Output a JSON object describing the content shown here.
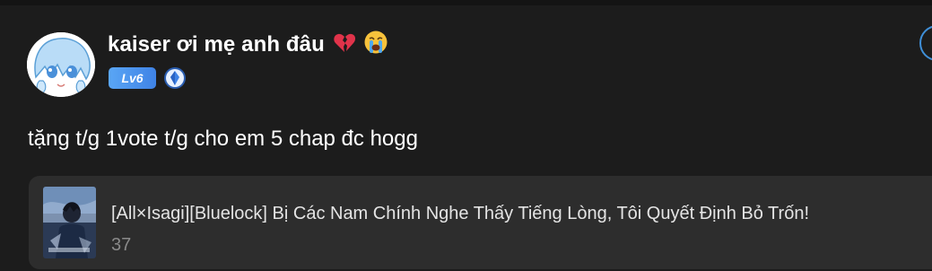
{
  "comment": {
    "username": "kaiser ơi mẹ anh đâu",
    "username_emojis": [
      "broken-heart",
      "loudly-crying-face"
    ],
    "level_label": "Lv6",
    "body": "tặng t/g 1vote t/g cho em 5 chap đc hogg"
  },
  "story": {
    "title": "[All×Isagi][Bluelock] Bị Các Nam Chính Nghe Thấy Tiếng Lòng, Tôi Quyết Định Bỏ Trốn!",
    "count": "37"
  },
  "colors": {
    "background": "#1c1c1c",
    "card": "#2d2d2d",
    "accent_blue": "#3f83e6",
    "muted_text": "#8a8a8a"
  }
}
